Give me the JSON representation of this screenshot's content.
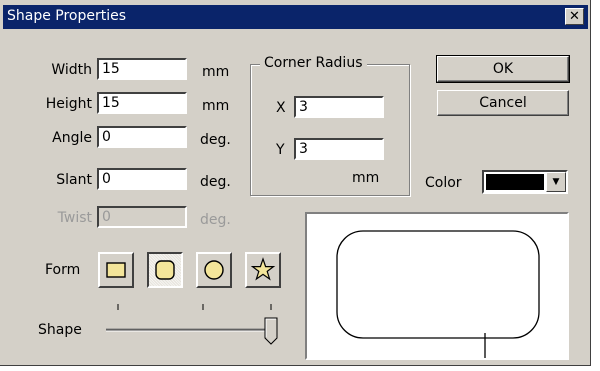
{
  "window": {
    "title": "Shape Properties",
    "close_glyph": "✕"
  },
  "fields": {
    "width": {
      "label": "Width",
      "value": "15",
      "unit": "mm"
    },
    "height": {
      "label": "Height",
      "value": "15",
      "unit": "mm"
    },
    "angle": {
      "label": "Angle",
      "value": "0",
      "unit": "deg."
    },
    "slant": {
      "label": "Slant",
      "value": "0",
      "unit": "deg."
    },
    "twist": {
      "label": "Twist",
      "value": "0",
      "unit": "deg.",
      "disabled": true
    }
  },
  "corner_radius": {
    "title": "Corner Radius",
    "x_label": "X",
    "x_value": "3",
    "y_label": "Y",
    "y_value": "3",
    "unit": "mm"
  },
  "buttons": {
    "ok": "OK",
    "cancel": "Cancel"
  },
  "color": {
    "label": "Color",
    "value": "#000000"
  },
  "form": {
    "label": "Form",
    "options": [
      {
        "name": "rectangle",
        "selected": false,
        "fill": "#f3e59a"
      },
      {
        "name": "rounded-rectangle",
        "selected": true,
        "fill": "#f3e59a"
      },
      {
        "name": "ellipse",
        "selected": false,
        "fill": "#f3e59a"
      },
      {
        "name": "star",
        "selected": false,
        "fill": "#f3e59a"
      }
    ]
  },
  "shape_slider": {
    "label": "Shape",
    "value_fraction": 1.0
  }
}
